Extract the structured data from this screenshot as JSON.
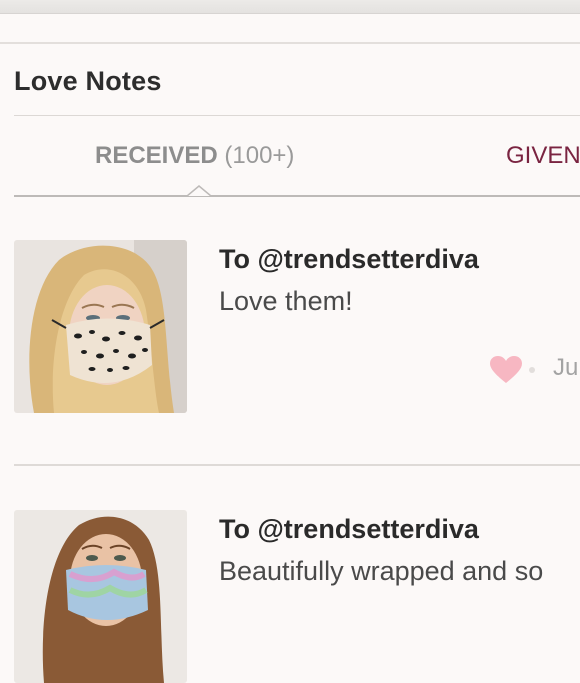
{
  "section": {
    "title": "Love Notes"
  },
  "tabs": [
    {
      "label": "RECEIVED",
      "count": "(100+)",
      "active": true
    },
    {
      "label": "GIVEN",
      "count": "",
      "active": false
    }
  ],
  "notes": [
    {
      "to": "To @trendsetterdiva",
      "body": "Love them!",
      "date": "Ju",
      "icon": "heart-icon",
      "thumb": "woman wearing leopard print face mask"
    },
    {
      "to": "To @trendsetterdiva",
      "body": "Beautifully wrapped and so",
      "date": "",
      "icon": "heart-icon",
      "thumb": "woman wearing tie-dye face mask"
    }
  ],
  "colors": {
    "background": "#fcf9f8",
    "given_tab": "#7a2441",
    "heart": "#f7b7c2"
  }
}
